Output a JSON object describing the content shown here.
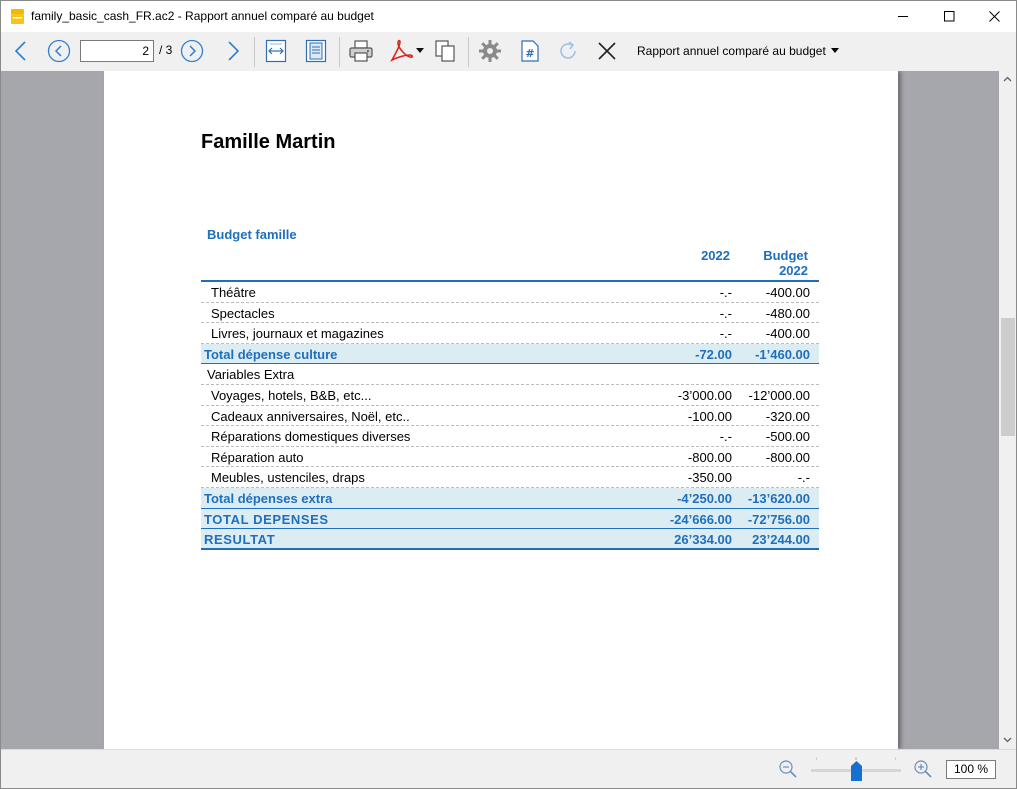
{
  "window": {
    "title": "family_basic_cash_FR.ac2 - Rapport annuel comparé au budget",
    "minimize_icon": "minimize-icon",
    "maximize_icon": "maximize-icon",
    "close_icon": "close-icon"
  },
  "toolbar": {
    "page_current": "2",
    "page_total": "/ 3",
    "report_name": "Rapport annuel comparé au budget",
    "icons": [
      "arrow-left-icon",
      "circle-left-icon",
      "circle-right-icon",
      "arrow-right-icon",
      "fit-width-icon",
      "fit-page-icon",
      "printer-icon",
      "pdf-icon",
      "copy-icon",
      "gear-icon",
      "hash-icon",
      "refresh-icon",
      "close-icon"
    ]
  },
  "report": {
    "company": "Famille Martin",
    "title": "Budget famille",
    "col1_header": "2022",
    "col2_header_line1": "Budget",
    "col2_header_line2": "2022",
    "rows": [
      {
        "label": "Théâtre",
        "v1": "-.-",
        "v2": "-400.00",
        "kind": "item"
      },
      {
        "label": "Spectacles",
        "v1": "-.-",
        "v2": "-480.00",
        "kind": "item"
      },
      {
        "label": "Livres, journaux et magazines",
        "v1": "-.-",
        "v2": "-400.00",
        "kind": "item"
      },
      {
        "label": "Total dépense culture",
        "v1": "-72.00",
        "v2": "-1’460.00",
        "kind": "total"
      },
      {
        "label": "Variables Extra",
        "v1": "",
        "v2": "",
        "kind": "group"
      },
      {
        "label": "Voyages, hotels, B&B, etc...",
        "v1": "-3’000.00",
        "v2": "-12’000.00",
        "kind": "item"
      },
      {
        "label": "Cadeaux anniversaires, Noël, etc..",
        "v1": "-100.00",
        "v2": "-320.00",
        "kind": "item"
      },
      {
        "label": "Réparations domestiques diverses",
        "v1": "-.-",
        "v2": "-500.00",
        "kind": "item"
      },
      {
        "label": "Réparation auto",
        "v1": "-800.00",
        "v2": "-800.00",
        "kind": "item"
      },
      {
        "label": "Meubles, ustenciles, draps",
        "v1": "-350.00",
        "v2": "-.-",
        "kind": "item"
      },
      {
        "label": "Total dépenses extra",
        "v1": "-4’250.00",
        "v2": "-13’620.00",
        "kind": "total"
      },
      {
        "label": "TOTAL DEPENSES",
        "v1": "-24’666.00",
        "v2": "-72’756.00",
        "kind": "total caps"
      },
      {
        "label": "RESULTAT",
        "v1": "26’334.00",
        "v2": "23’244.00",
        "kind": "total caps final"
      }
    ]
  },
  "status": {
    "zoom": "100 %",
    "zoom_out_icon": "zoom-out-icon",
    "zoom_in_icon": "zoom-in-icon"
  },
  "colors": {
    "accent": "#1f6fbd",
    "total_bg": "#dcecf3",
    "viewport_bg": "#a6a6ad"
  }
}
